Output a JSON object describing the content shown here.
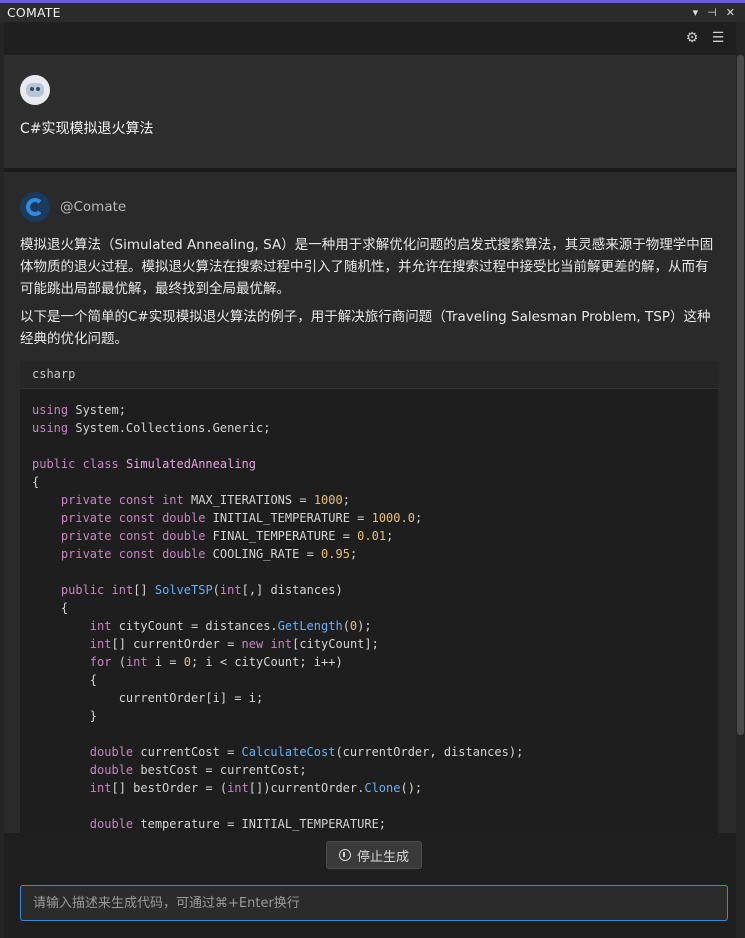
{
  "window": {
    "title": "COMATE",
    "controls": [
      "▾",
      "⊣",
      "✕"
    ]
  },
  "toolbar": {
    "icons": [
      "gear-icon",
      "list-icon"
    ]
  },
  "user": {
    "message": "C#实现模拟退火算法"
  },
  "bot": {
    "name": "@Comate",
    "para1": "模拟退火算法（Simulated Annealing, SA）是一种用于求解优化问题的启发式搜索算法，其灵感来源于物理学中固体物质的退火过程。模拟退火算法在搜索过程中引入了随机性，并允许在搜索过程中接受比当前解更差的解，从而有可能跳出局部最优解，最终找到全局最优解。",
    "para2": "以下是一个简单的C#实现模拟退火算法的例子，用于解决旅行商问题（Traveling Salesman Problem, TSP）这种经典的优化问题。",
    "code_lang": "csharp"
  },
  "footer": {
    "stop_label": "停止生成",
    "input_placeholder": "请输入描述来生成代码，可通过⌘+Enter换行"
  },
  "colors": {
    "accent": "#6b5bd2",
    "input_border": "#3b8ad9"
  }
}
